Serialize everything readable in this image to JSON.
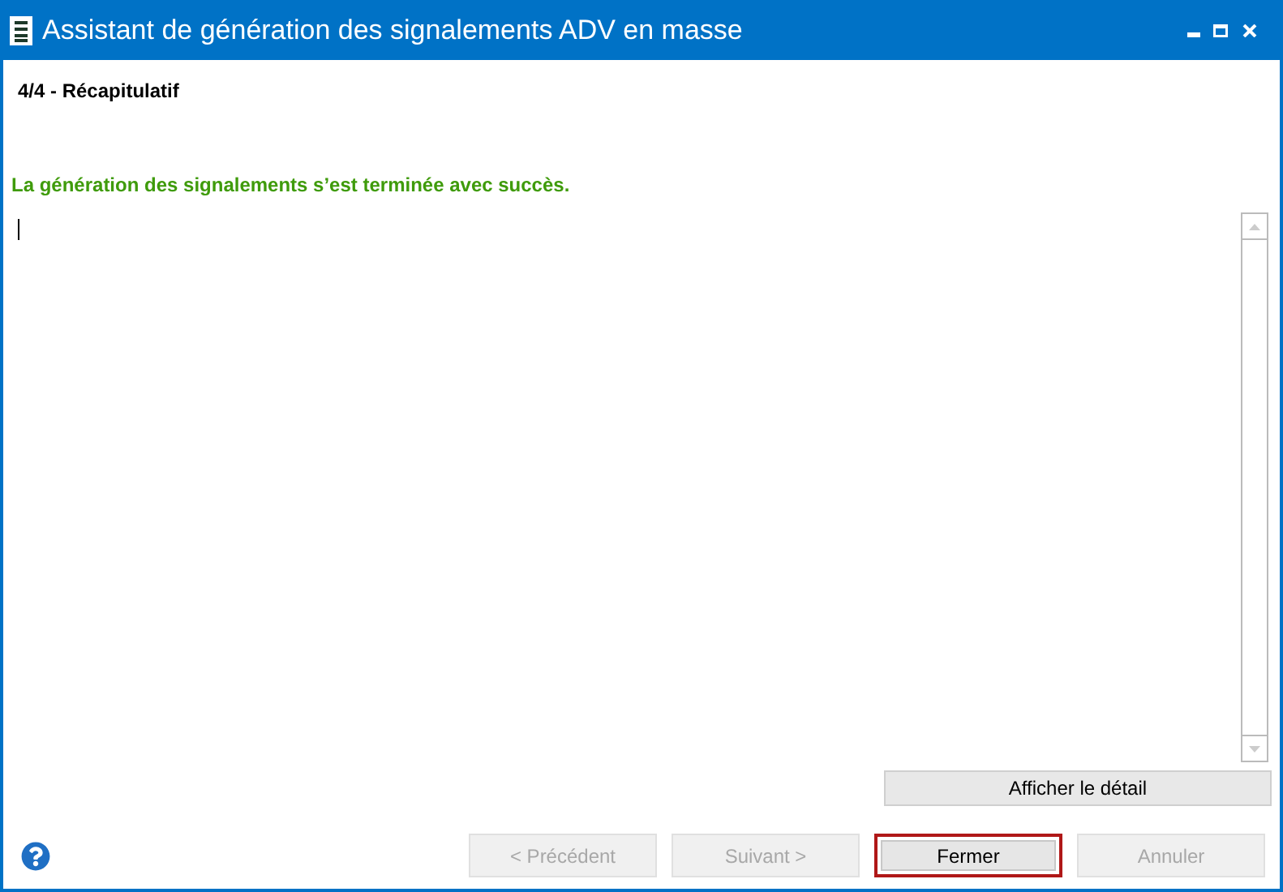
{
  "window": {
    "title": "Assistant de génération des signalements ADV en masse"
  },
  "step": "4/4 - Récapitulatif",
  "message": "La génération des signalements s’est terminée avec succès.",
  "detail_button": "Afficher le détail",
  "buttons": [
    {
      "label": "< Précédent",
      "disabled": true,
      "focused": false
    },
    {
      "label": "Suivant >",
      "disabled": true,
      "focused": false
    },
    {
      "label": "Fermer",
      "disabled": false,
      "focused": true
    },
    {
      "label": "Annuler",
      "disabled": true,
      "focused": false
    }
  ]
}
